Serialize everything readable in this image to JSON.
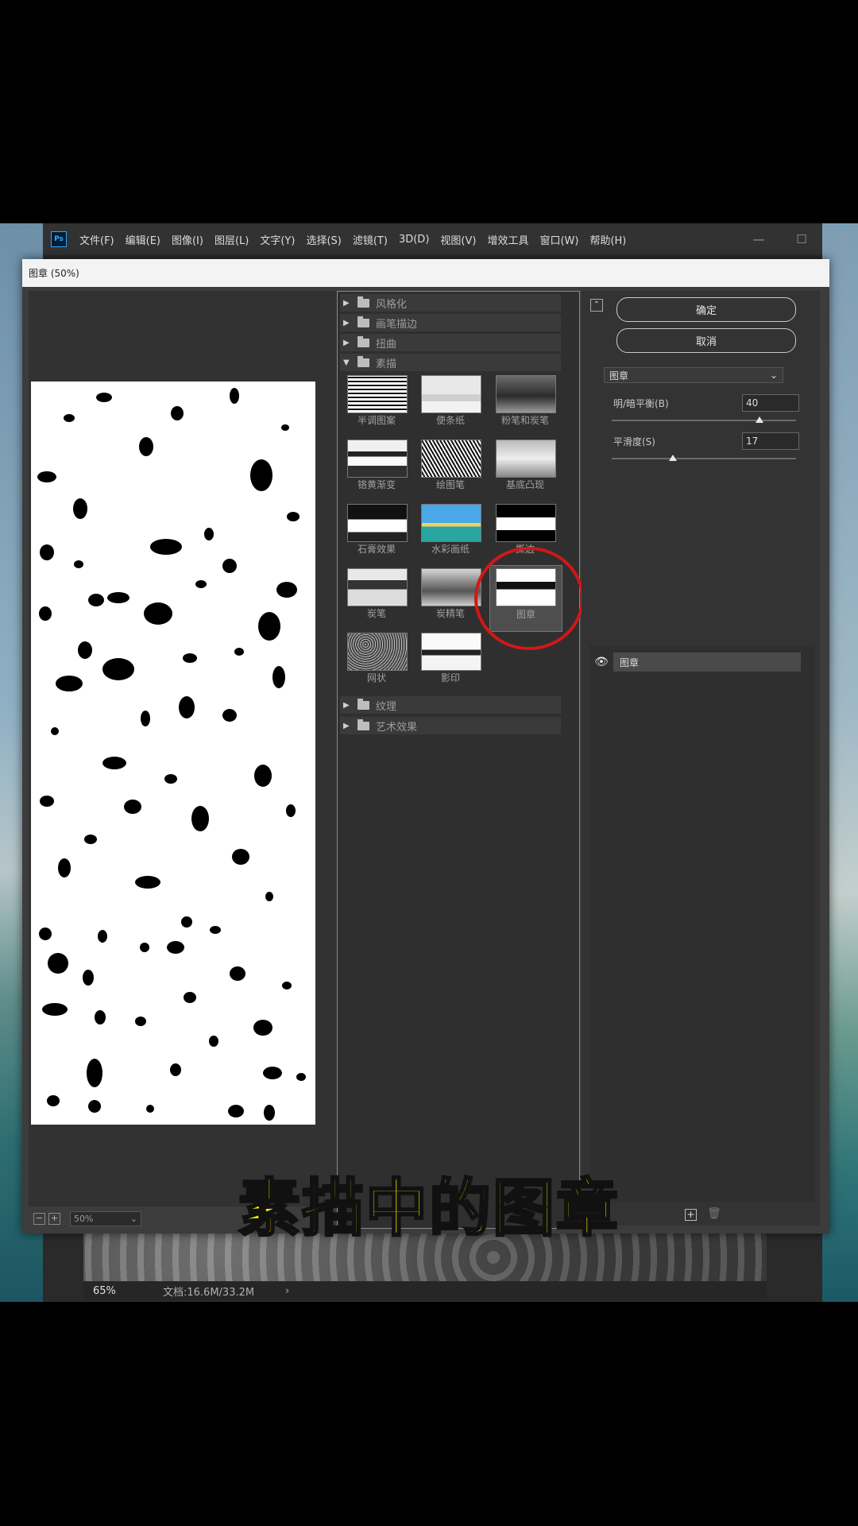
{
  "app": {
    "logo": "Ps",
    "menu": [
      "文件(F)",
      "编辑(E)",
      "图像(I)",
      "图层(L)",
      "文字(Y)",
      "选择(S)",
      "滤镜(T)",
      "3D(D)",
      "视图(V)",
      "增效工具",
      "窗口(W)",
      "帮助(H)"
    ],
    "window_controls": [
      "—",
      "☐",
      "✕"
    ]
  },
  "dialog": {
    "title": "图章 (50%)",
    "zoom": "50%",
    "zoom_minus": "−",
    "zoom_plus": "+"
  },
  "filter_gallery": {
    "categories_top": [
      {
        "label": "风格化",
        "expanded": false
      },
      {
        "label": "画笔描边",
        "expanded": false
      },
      {
        "label": "扭曲",
        "expanded": false
      },
      {
        "label": "素描",
        "expanded": true
      }
    ],
    "sketch_filters": [
      {
        "label": "半调图案",
        "icon": "halftone-thumbnail"
      },
      {
        "label": "便条纸",
        "icon": "note-paper-thumbnail"
      },
      {
        "label": "粉笔和炭笔",
        "icon": "chalk-charcoal-thumbnail"
      },
      {
        "label": "铬黄渐变",
        "icon": "chrome-thumbnail"
      },
      {
        "label": "绘图笔",
        "icon": "graphic-pen-thumbnail"
      },
      {
        "label": "基底凸现",
        "icon": "bas-relief-thumbnail"
      },
      {
        "label": "石膏效果",
        "icon": "plaster-thumbnail"
      },
      {
        "label": "水彩画纸",
        "icon": "water-paper-thumbnail"
      },
      {
        "label": "撕边",
        "icon": "torn-edges-thumbnail"
      },
      {
        "label": "炭笔",
        "icon": "charcoal-thumbnail"
      },
      {
        "label": "炭精笔",
        "icon": "conte-crayon-thumbnail"
      },
      {
        "label": "图章",
        "icon": "stamp-thumbnail",
        "selected": true
      },
      {
        "label": "网状",
        "icon": "reticulation-thumbnail"
      },
      {
        "label": "影印",
        "icon": "photocopy-thumbnail"
      }
    ],
    "categories_bottom": [
      {
        "label": "纹理",
        "expanded": false
      },
      {
        "label": "艺术效果",
        "expanded": false
      }
    ]
  },
  "settings": {
    "ok_label": "确定",
    "cancel_label": "取消",
    "filter_select": "图章",
    "params": [
      {
        "label": "明/暗平衡(B)",
        "value": "40",
        "slider_fraction": 0.8
      },
      {
        "label": "平滑度(S)",
        "value": "17",
        "slider_fraction": 0.33
      }
    ],
    "layer_name": "图章"
  },
  "status_bar": {
    "zoom": "65%",
    "doc_info": "文档:16.6M/33.2M",
    "arrow": "›"
  },
  "caption": "素描中的图章",
  "colors": {
    "highlight_ring": "#d01818",
    "caption_text": "#fff200"
  }
}
